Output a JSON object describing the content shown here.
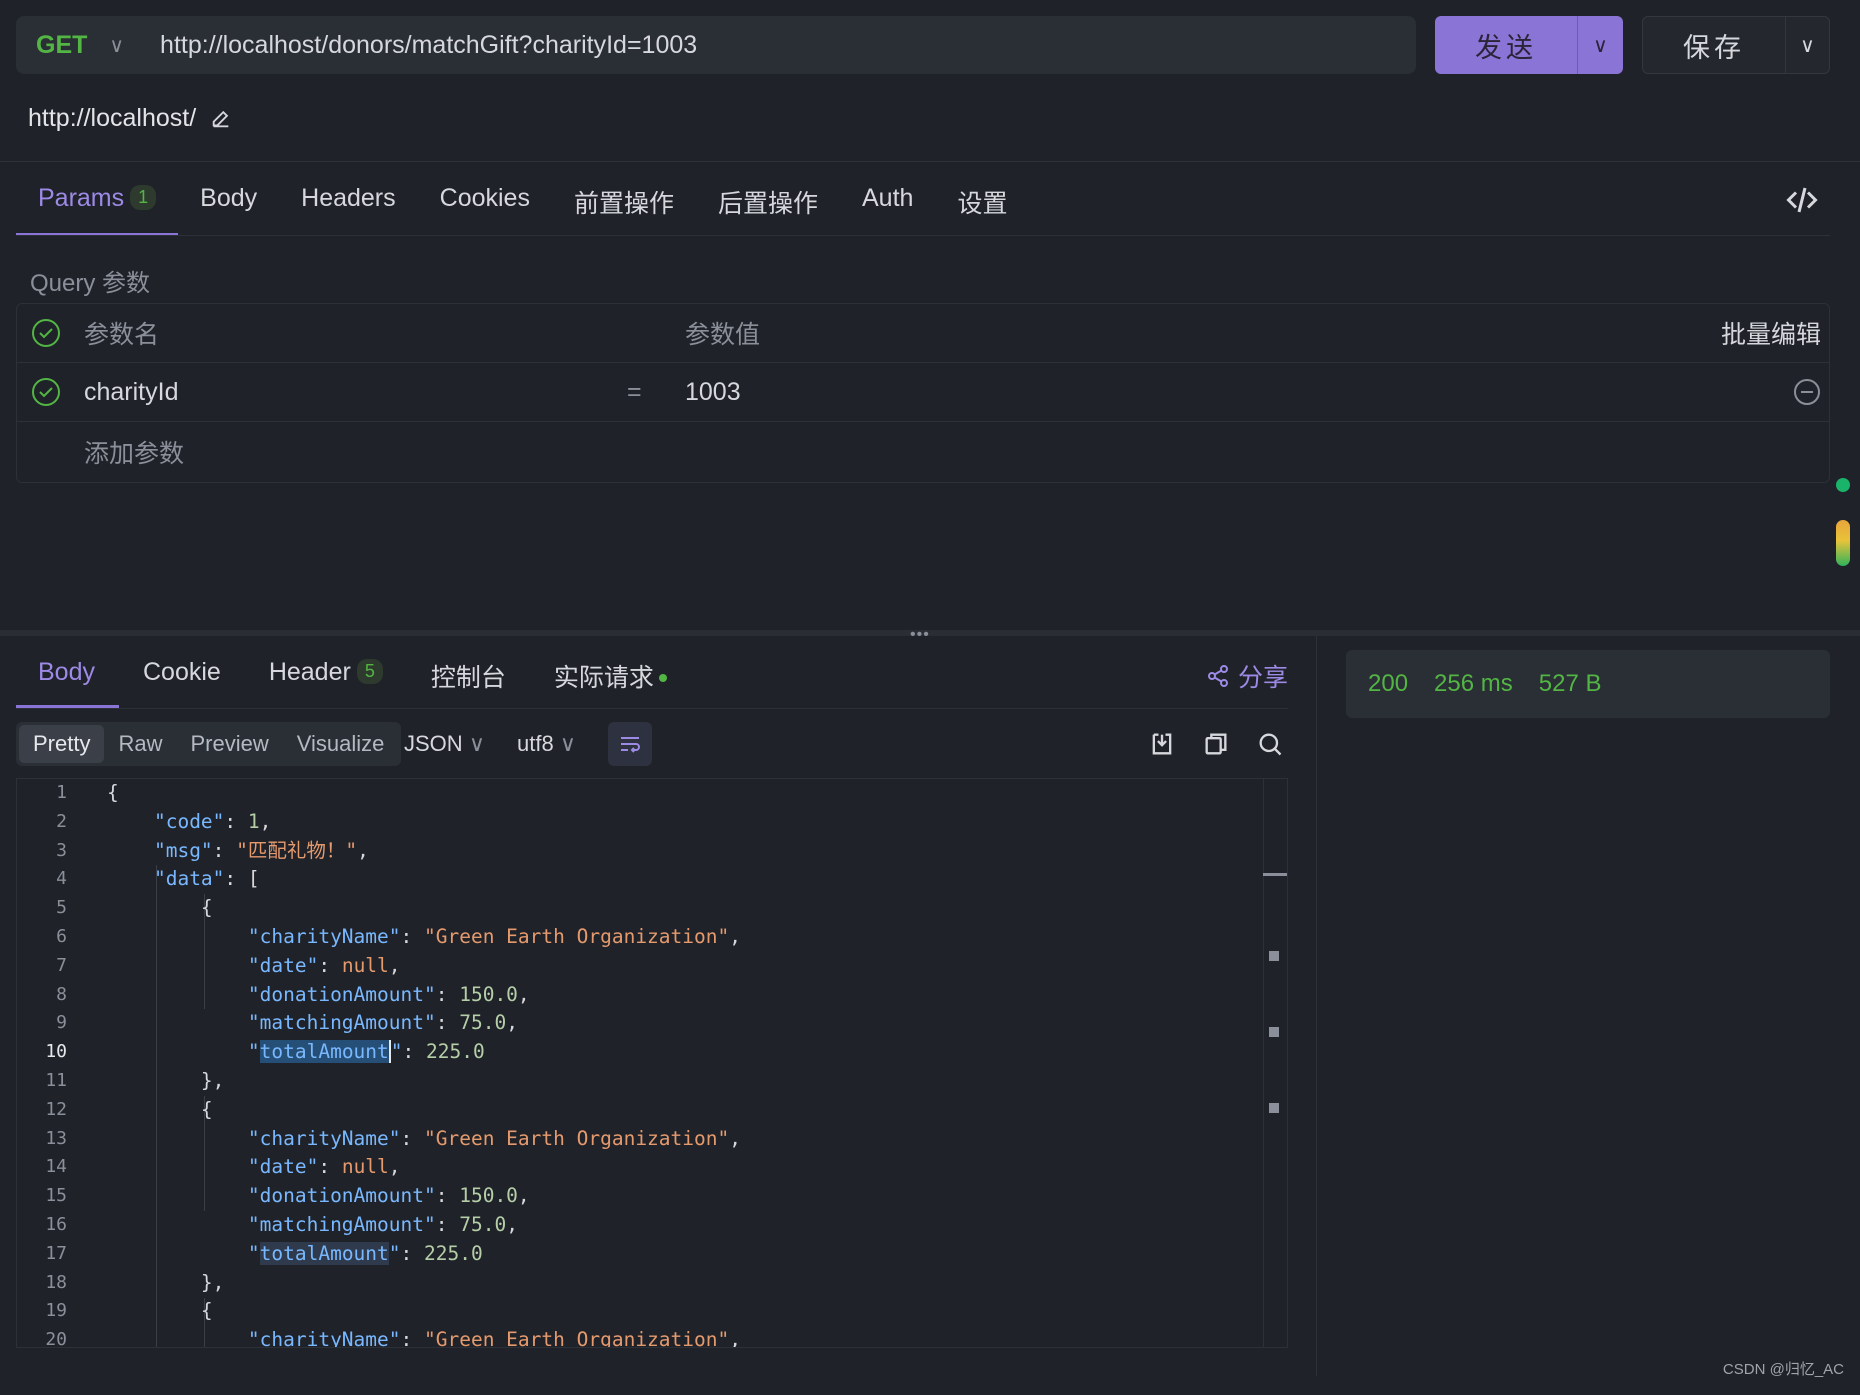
{
  "request": {
    "method": "GET",
    "url": "http://localhost/donors/matchGift?charityId=1003",
    "send_label": "发送",
    "save_label": "保存",
    "base_url": "http://localhost/"
  },
  "request_tabs": [
    {
      "label": "Params",
      "badge": "1"
    },
    {
      "label": "Body"
    },
    {
      "label": "Headers"
    },
    {
      "label": "Cookies"
    },
    {
      "label": "前置操作"
    },
    {
      "label": "后置操作"
    },
    {
      "label": "Auth"
    },
    {
      "label": "设置"
    }
  ],
  "query": {
    "title": "Query 参数",
    "col_name": "参数名",
    "col_value": "参数值",
    "bulk_edit": "批量编辑",
    "params": [
      {
        "name": "charityId",
        "eq": "=",
        "value": "1003"
      }
    ],
    "add_placeholder": "添加参数"
  },
  "response_tabs": [
    {
      "label": "Body"
    },
    {
      "label": "Cookie"
    },
    {
      "label": "Header",
      "badge": "5"
    },
    {
      "label": "控制台"
    },
    {
      "label": "实际请求"
    }
  ],
  "share_label": "分享",
  "view_modes": [
    "Pretty",
    "Raw",
    "Preview",
    "Visualize"
  ],
  "format": "JSON",
  "encoding": "utf8",
  "status": {
    "code": "200",
    "time": "256 ms",
    "size": "527 B"
  },
  "line_numbers": [
    "1",
    "2",
    "3",
    "4",
    "5",
    "6",
    "7",
    "8",
    "9",
    "10",
    "11",
    "12",
    "13",
    "14",
    "15",
    "16",
    "17",
    "18",
    "19",
    "20"
  ],
  "json": {
    "code_key": "\"code\"",
    "code_val": "1",
    "msg_key": "\"msg\"",
    "msg_val": "\"匹配礼物！\"",
    "data_key": "\"data\"",
    "charity_key": "\"charityName\"",
    "charity_val": "\"Green Earth Organization\"",
    "date_key": "\"date\"",
    "date_val": "null",
    "donation_key": "\"donationAmount\"",
    "donation_val": "150.0",
    "matching_key": "\"matchingAmount\"",
    "matching_val": "75.0",
    "total_key_word": "totalAmount",
    "total_val": "225.0"
  },
  "watermark": "CSDN @归忆_AC"
}
